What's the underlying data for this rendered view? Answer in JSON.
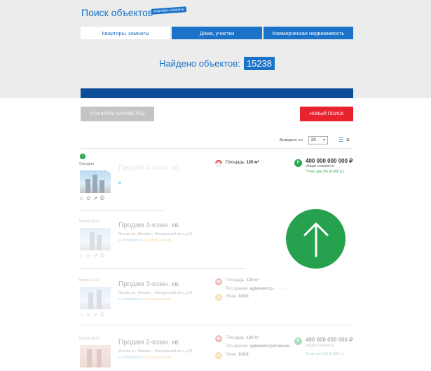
{
  "header": {
    "title": "Поиск объектов",
    "badge": "квартиры, комнаты"
  },
  "tabs": [
    {
      "label": "Квартиры, комнаты",
      "active": true
    },
    {
      "label": "Дома, участки",
      "active": false
    },
    {
      "label": "Коммерческая недвижимость",
      "active": false
    }
  ],
  "found": {
    "label": "Найдено объектов:",
    "count": "15238"
  },
  "actions": {
    "refine_label": "УТОЧНИТЬ ПАРАМЕТРЫ",
    "new_search_label": "НОВЫЙ ПОИСК"
  },
  "pagination": {
    "per_page_label": "Выводить по:",
    "per_page_value": "20"
  },
  "listings": [
    {
      "date": "Сегодня",
      "title": "Продам 4-комн. кв.",
      "address": "",
      "metro": "м",
      "metro2": "",
      "area_label": "Площадь:",
      "area": "120 м²",
      "type_label": "",
      "type": "",
      "floor_label": "",
      "floor": "",
      "price": "400 000 000 000 ₽",
      "price_sub": "общая стоимость",
      "bonus": "Бонус аин 2% (8 000 р.)"
    },
    {
      "date": "Вчера 2020",
      "title": "Продам 4-комн. кв.",
      "address": "Москва ул., Москва г., Мичуринский пр-т, д.34",
      "metro": "м. Бибирево/м",
      "metro2": "м. Бабушкинская",
      "area_label": "Площадь:",
      "area": "120 м²",
      "type_label": "Тип здания:",
      "type": "административное",
      "floor_label": "Этаж:",
      "floor": "10/24",
      "price": "",
      "price_sub": "",
      "bonus": ""
    },
    {
      "date": "Вчера 2020",
      "title": "Продам 3-комн. кв.",
      "address": "Москва ул., Москва г., Мичуринский пр-т, д.34",
      "metro": "м. Бибирево/м",
      "metro2": "м. Бабушкинская",
      "area_label": "Площадь:",
      "area": "120 м²",
      "type_label": "Тип здания:",
      "type": "административное",
      "floor_label": "Этаж:",
      "floor": "10/24",
      "price": "",
      "price_sub": "",
      "bonus": ""
    },
    {
      "date": "Вчера 2020",
      "title": "Продам 2-комн. кв.",
      "address": "Москва ул., Москва г., Мичуринский пр-т, д.34",
      "metro": "м. Бибирево/м",
      "metro2": "м. Бабушкинская",
      "area_label": "Площадь:",
      "area": "120 м²",
      "type_label": "Тип здания:",
      "type": "административное",
      "floor_label": "Этаж:",
      "floor": "10/24",
      "price": "400 000 000 000 ₽",
      "price_sub": "общая стоимость",
      "bonus": "Бонус аин 2% (8 000 р.)"
    }
  ],
  "icons": {
    "scroll_up": "arrow-up-icon",
    "favorite": "star-icon",
    "compare": "compare-icon",
    "share": "share-icon",
    "print": "print-icon",
    "area": "area-icon",
    "type": "building-icon",
    "floor": "floor-icon",
    "price": "price-icon",
    "bonus": "gift-icon"
  },
  "colors": {
    "accent": "#1a73c8",
    "dark_accent": "#0e4e99",
    "danger": "#e8232e",
    "success": "#29a84e"
  }
}
